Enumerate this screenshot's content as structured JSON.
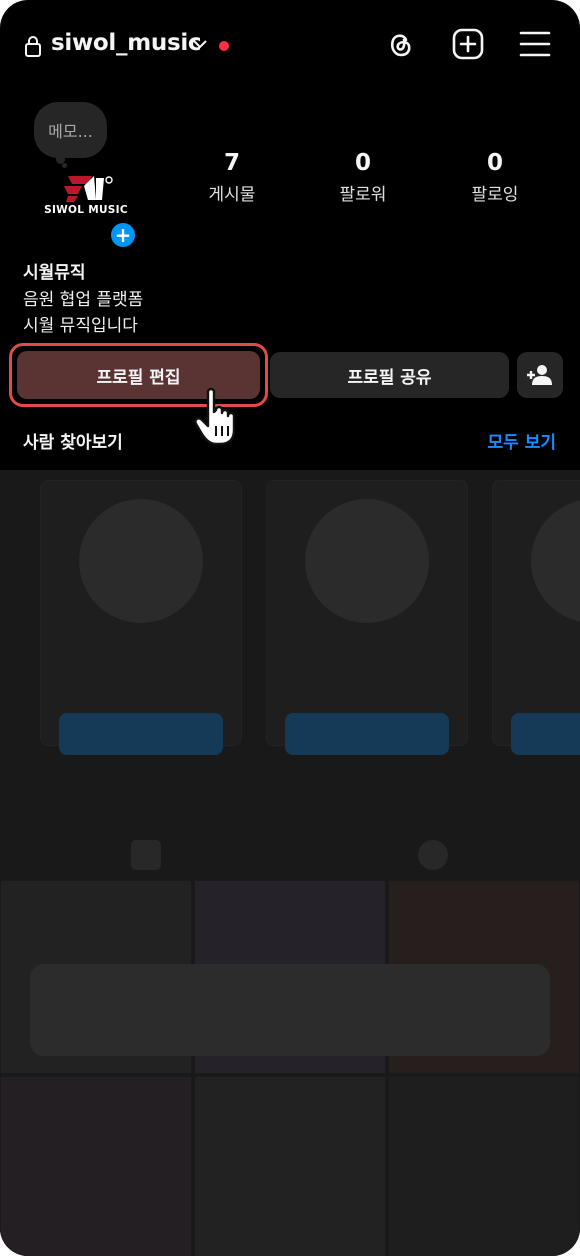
{
  "header": {
    "username": "siwol_music",
    "icons": [
      "lock-icon",
      "chevron-down-icon",
      "threads-icon",
      "add-post-icon",
      "menu-icon"
    ]
  },
  "memo": {
    "text": "메모..."
  },
  "profile": {
    "logo_text": "SIWOL MUSIC",
    "add_story_symbol": "+"
  },
  "stats": [
    {
      "value": "7",
      "label": "게시물"
    },
    {
      "value": "0",
      "label": "팔로워"
    },
    {
      "value": "0",
      "label": "팔로잉"
    }
  ],
  "bio": {
    "name": "시월뮤직",
    "lines": [
      "음원 협업 플랫폼",
      "시월 뮤직입니다"
    ]
  },
  "buttons": {
    "edit_profile": "프로필 편집",
    "share_profile": "프로필 공유"
  },
  "discover": {
    "title": "사람 찾아보기",
    "see_all": "모두 보기"
  },
  "colors": {
    "background": "#000000",
    "accent_blue": "#0095f6",
    "link_blue": "#1a8cff",
    "highlight_ring": "#e24b4b",
    "notification_dot": "#ff3040"
  }
}
